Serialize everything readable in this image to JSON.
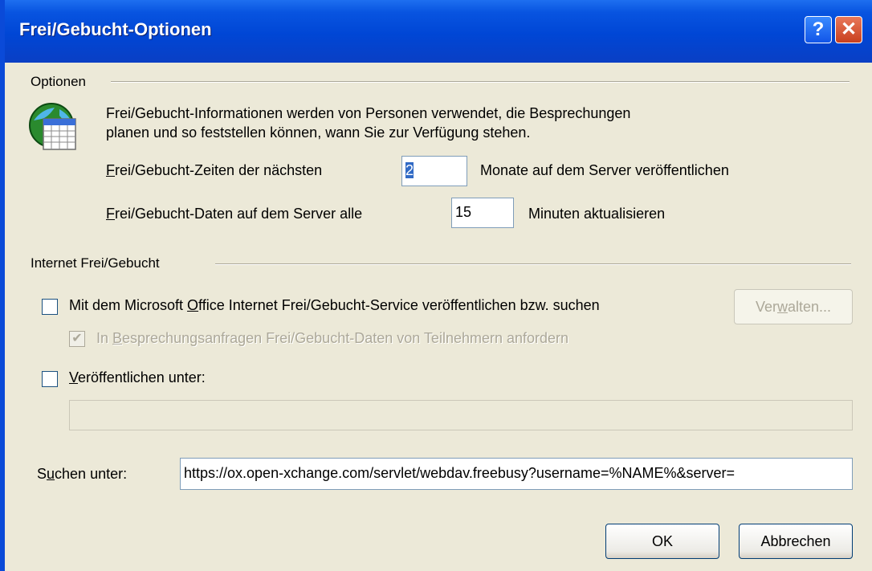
{
  "window": {
    "title": "Frei/Gebucht-Optionen",
    "help_glyph": "?",
    "close_glyph": "✕"
  },
  "optionen": {
    "group_label": "Optionen",
    "description_line1": "Frei/Gebucht-Informationen werden von Personen verwendet, die Besprechungen",
    "description_line2": "planen und so feststellen können, wann Sie zur Verfügung stehen.",
    "months_label_pre": "F",
    "months_label_rest": "rei/Gebucht-Zeiten der nächsten",
    "months_value": "2",
    "months_suffix": "Monate auf dem Server veröffentlichen",
    "interval_label_pre": "F",
    "interval_label_rest": "rei/Gebucht-Daten auf dem Server alle",
    "interval_value": "15",
    "interval_suffix": "Minuten aktualisieren"
  },
  "internet": {
    "group_label": "Internet Frei/Gebucht",
    "publish_ms_label_a": "Mit dem Microsoft ",
    "publish_ms_label_u": "O",
    "publish_ms_label_b": "ffice Internet Frei/Gebucht-Service veröffentlichen bzw. suchen",
    "manage_label_a": "Ver",
    "manage_label_u": "w",
    "manage_label_b": "alten...",
    "request_label_a": "In ",
    "request_label_u": "B",
    "request_label_b": "esprechungsanfragen Frei/Gebucht-Daten von Teilnehmern anfordern",
    "request_check_glyph": "✔",
    "publish_at_label_u": "V",
    "publish_at_label_rest": "eröffentlichen unter:",
    "publish_at_value": "",
    "search_label_a": "S",
    "search_label_u": "u",
    "search_label_b": "chen unter:",
    "search_value": "https://ox.open-xchange.com/servlet/webdav.freebusy?username=%NAME%&server="
  },
  "buttons": {
    "ok": "OK",
    "cancel": "Abbrechen"
  },
  "icons": {
    "calendar": "calendar-globe-icon"
  }
}
